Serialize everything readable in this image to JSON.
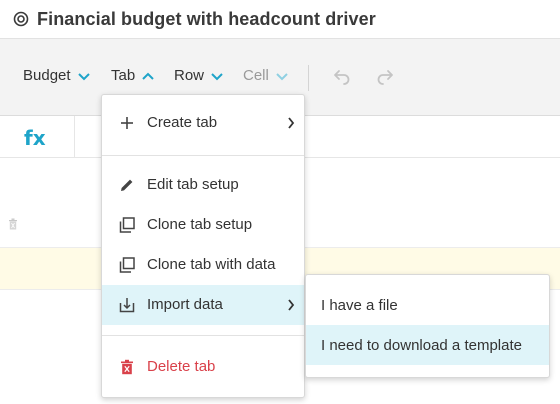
{
  "header": {
    "title": "Financial budget with headcount driver",
    "icon": "target-icon"
  },
  "toolbar": {
    "items": [
      {
        "label": "Budget",
        "state": "collapsed"
      },
      {
        "label": "Tab",
        "state": "expanded"
      },
      {
        "label": "Row",
        "state": "collapsed"
      },
      {
        "label": "Cell",
        "state": "disabled"
      }
    ],
    "undo_icon": "undo-icon",
    "redo_icon": "redo-icon"
  },
  "formula_bar": {
    "label": "fx"
  },
  "tab_menu": {
    "create_tab": "Create tab",
    "edit_tab_setup": "Edit tab setup",
    "clone_tab_setup": "Clone tab setup",
    "clone_tab_with_data": "Clone tab with data",
    "import_data": "Import data",
    "delete_tab": "Delete tab"
  },
  "import_submenu": {
    "have_file": "I have a file",
    "need_template": "I need to download a template"
  },
  "colors": {
    "accent": "#1ea4c9",
    "danger": "#d9414a",
    "highlight": "#dff4f9",
    "toolbar_bg": "#f3f3f3",
    "row_highlight": "#fffbe6"
  }
}
